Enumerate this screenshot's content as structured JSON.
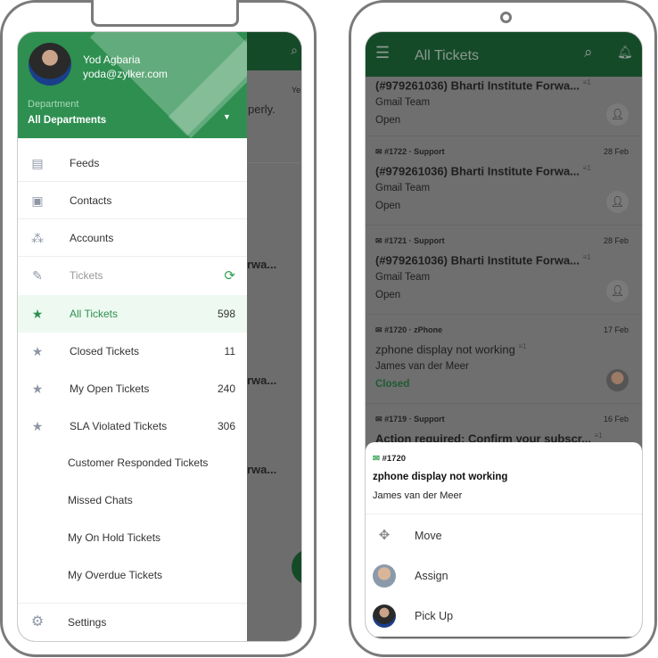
{
  "drawer": {
    "user_name": "Yod Agbaria",
    "user_email": "yoda@zylker.com",
    "department_label": "Department",
    "department_value": "All Departments",
    "items": [
      {
        "label": "Feeds",
        "icon": "feeds-icon"
      },
      {
        "label": "Contacts",
        "icon": "contact-card-icon"
      },
      {
        "label": "Accounts",
        "icon": "accounts-icon"
      },
      {
        "label": "Tickets",
        "icon": "tickets-icon"
      },
      {
        "label": "All Tickets",
        "count": "598",
        "icon": "star-icon"
      },
      {
        "label": "Closed Tickets",
        "count": "11",
        "icon": "star-icon"
      },
      {
        "label": "My Open Tickets",
        "count": "240",
        "icon": "star-icon"
      },
      {
        "label": "SLA Violated Tickets",
        "count": "306",
        "icon": "star-icon"
      },
      {
        "label": "Customer Responded Tickets"
      },
      {
        "label": "Missed Chats"
      },
      {
        "label": "My On Hold Tickets"
      },
      {
        "label": "My Overdue Tickets"
      }
    ],
    "settings": "Settings"
  },
  "background": {
    "snippet1": "Ye",
    "snippet2": "perly.",
    "snippet3": "rwa...",
    "thread": "≡1",
    "snippet4": "ke",
    "snippet5": "9"
  },
  "right": {
    "title": "All Tickets",
    "tickets": [
      {
        "subject": "(#979261036) Bharti Institute Forwa...",
        "threads": "1",
        "customer": "Gmail Team",
        "status": "Open"
      },
      {
        "number": "#1722",
        "dept": "Support",
        "date": "28 Feb",
        "subject": "(#979261036) Bharti Institute Forwa...",
        "threads": "1",
        "customer": "Gmail Team",
        "status": "Open"
      },
      {
        "number": "#1721",
        "dept": "Support",
        "date": "28 Feb",
        "subject": "(#979261036) Bharti Institute Forwa...",
        "threads": "1",
        "customer": "Gmail Team",
        "status": "Open"
      },
      {
        "number": "#1720",
        "dept": "zPhone",
        "date": "17 Feb",
        "subject": "zphone display not working",
        "threads": "1",
        "customer": "James van der Meer",
        "status": "Closed"
      },
      {
        "number": "#1719",
        "dept": "Support",
        "date": "16 Feb",
        "subject": "Action required: Confirm your subscr...",
        "threads": "1"
      }
    ],
    "sheet": {
      "number": "#1720",
      "subject": "zphone display not working",
      "customer": "James van der Meer",
      "actions": [
        "Move",
        "Assign",
        "Pick Up"
      ]
    }
  },
  "colors": {
    "green": "#2e8f50",
    "closed": "#1f6b3a",
    "selected_bg": "#eefaf1"
  }
}
